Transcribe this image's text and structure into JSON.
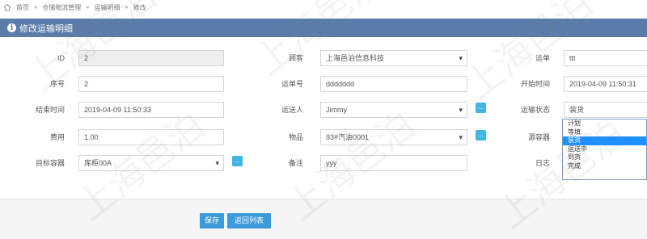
{
  "breadcrumb": {
    "items": [
      "首页",
      "仓储物流管理",
      "运输明细",
      "修改"
    ]
  },
  "panel": {
    "title": "修改运输明细"
  },
  "form": {
    "id": {
      "label": "ID",
      "value": "2"
    },
    "customer": {
      "label": "顾客",
      "value": "上海邑泊信息科技"
    },
    "shipping_order": {
      "label": "运单",
      "value": "ttt"
    },
    "seq": {
      "label": "序号",
      "value": "2"
    },
    "waybill_no": {
      "label": "运单号",
      "value": "ddddddd"
    },
    "start_time": {
      "label": "开始时间",
      "value": "2019-04-09 11:50:31"
    },
    "end_time": {
      "label": "结束时间",
      "value": "2019-04-09 11:50:33"
    },
    "transporter": {
      "label": "运送人",
      "value": "Jimmy"
    },
    "transport_status": {
      "label": "运输状态",
      "value": "装货"
    },
    "cost": {
      "label": "费用",
      "value": "1.00"
    },
    "item": {
      "label": "物品",
      "value": "93#汽油0001"
    },
    "source_container": {
      "label": "源容器",
      "value": ""
    },
    "target_container": {
      "label": "目标容器",
      "value": "库柜00A"
    },
    "remark": {
      "label": "备注",
      "value": "yyy"
    },
    "log": {
      "label": "日志",
      "value": ""
    }
  },
  "status_options": [
    "计划",
    "等填",
    "装货",
    "运送中",
    "到货",
    "完成"
  ],
  "status_selected_index": 2,
  "buttons": {
    "save": "保存",
    "back": "返回列表",
    "plus": "..."
  },
  "watermark_text": "上海邑泊",
  "colors": {
    "header": "#5b7ba8",
    "button": "#3d9ad9",
    "plus": "#3fb5e0",
    "selected_option": "#1e90ff"
  }
}
